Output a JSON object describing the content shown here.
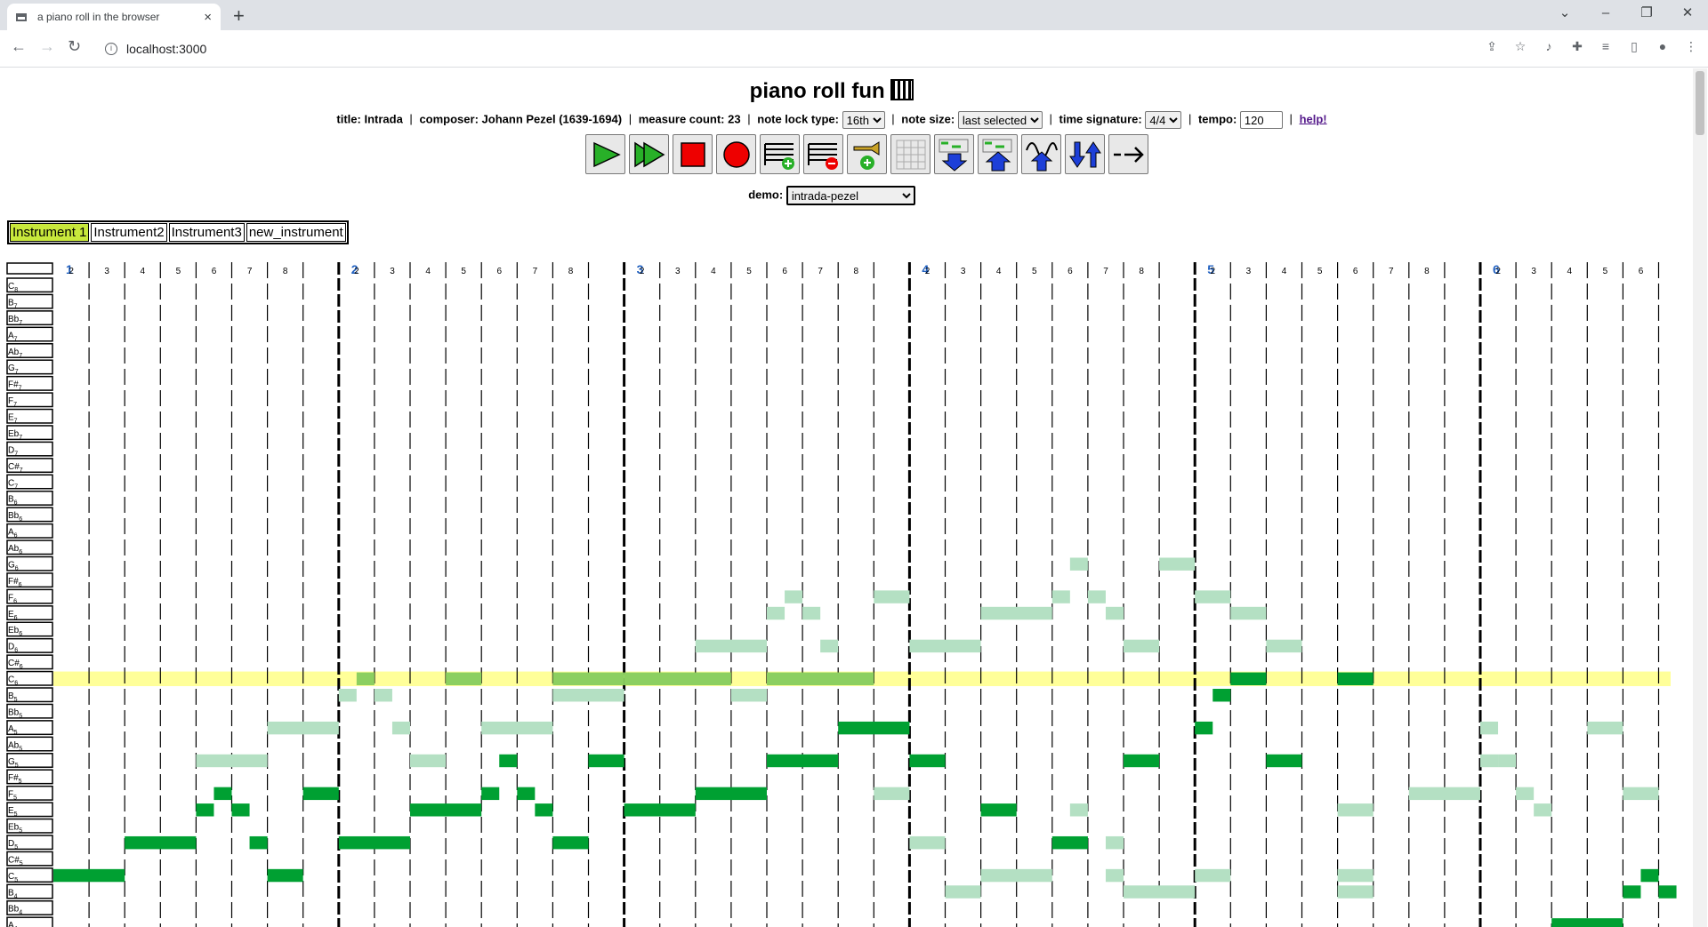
{
  "browser": {
    "tab_title": "a piano roll in the browser",
    "close_glyph": "×",
    "new_tab_glyph": "+",
    "url": "localhost:3000",
    "window_buttons": [
      "⌄",
      "–",
      "❐",
      "✕"
    ]
  },
  "page": {
    "title": "piano roll fun",
    "controls": {
      "title_label": "title:",
      "title_value": "Intrada",
      "composer_label": "composer:",
      "composer_value": "Johann Pezel (1639-1694)",
      "measure_label": "measure count:",
      "measure_value": "23",
      "note_lock_label": "note lock type:",
      "note_lock_value": "16th",
      "note_size_label": "note size:",
      "note_size_value": "last selected",
      "time_sig_label": "time signature:",
      "time_sig_value": "4/4",
      "tempo_label": "tempo:",
      "tempo_value": "120",
      "help_label": "help!"
    },
    "toolbar_buttons": [
      "play",
      "play-all",
      "stop",
      "record",
      "add-measure",
      "remove-measure",
      "add-instrument",
      "toggle-grid",
      "move-down",
      "move-up",
      "wave",
      "transpose",
      "arrow"
    ],
    "demo_label": "demo:",
    "demo_value": "intrada-pezel",
    "instruments": [
      "Instrument 1",
      "Instrument2",
      "Instrument3",
      "new_instrument"
    ],
    "active_instrument": 0
  },
  "roll": {
    "pitch_labels": [
      "C8",
      "B7",
      "Bb7",
      "A7",
      "Ab7",
      "G7",
      "F#7",
      "F7",
      "E7",
      "Eb7",
      "D7",
      "C#7",
      "C7",
      "B6",
      "Bb6",
      "A6",
      "Ab6",
      "G6",
      "F#6",
      "F6",
      "E6",
      "Eb6",
      "D6",
      "C#6",
      "C6",
      "B5",
      "Bb5",
      "A5",
      "Ab5",
      "G5",
      "F#5",
      "F5",
      "E5",
      "Eb5",
      "D5",
      "C#5",
      "C5",
      "B4",
      "Bb4",
      "A4"
    ],
    "highlight_row": "C6",
    "measures": [
      1,
      2,
      3,
      4,
      5,
      6
    ],
    "subdivision_labels": [
      "2",
      "3",
      "4",
      "5",
      "6",
      "7",
      "8"
    ],
    "colors": {
      "active_note": "#00a032",
      "other_note": "#b4e0c3",
      "highlight": "#ffff99",
      "highlight_note": "#8ccf60",
      "measure_num": "#2060c0"
    },
    "active_notes": [
      [
        "C5",
        0,
        2
      ],
      [
        "D5",
        2,
        2
      ],
      [
        "F5",
        4.5,
        0.5
      ],
      [
        "E5",
        4,
        0.5
      ],
      [
        "E5",
        5,
        0.5
      ],
      [
        "D5",
        5.5,
        0.5
      ],
      [
        "C5",
        6,
        1
      ],
      [
        "F5",
        7,
        1
      ],
      [
        "D5",
        8,
        2
      ],
      [
        "E5",
        10,
        2
      ],
      [
        "F5",
        12,
        0.5
      ],
      [
        "G5",
        12.5,
        0.5
      ],
      [
        "F5",
        13,
        0.5
      ],
      [
        "E5",
        13.5,
        0.5
      ],
      [
        "D5",
        14,
        1
      ],
      [
        "G5",
        15,
        1
      ],
      [
        "E5",
        16,
        2
      ],
      [
        "F5",
        18,
        2
      ],
      [
        "G5",
        20,
        2
      ],
      [
        "A5",
        22,
        2
      ],
      [
        "G5",
        24,
        1
      ],
      [
        "E5",
        26,
        1
      ],
      [
        "D5",
        28,
        1
      ],
      [
        "G5",
        30,
        1
      ],
      [
        "A5",
        32,
        0.5
      ],
      [
        "B5",
        32.5,
        0.5
      ],
      [
        "C6",
        33,
        1
      ],
      [
        "G5",
        34,
        1
      ],
      [
        "C6",
        36,
        1
      ],
      [
        "C5",
        44.5,
        0.5
      ],
      [
        "B4",
        44,
        0.5
      ],
      [
        "B4",
        45,
        0.5
      ],
      [
        "A4",
        42,
        2
      ]
    ],
    "other_notes": [
      [
        "G5",
        4,
        2
      ],
      [
        "A5",
        6,
        2
      ],
      [
        "B5",
        8,
        0.5
      ],
      [
        "C6",
        8.5,
        0.5
      ],
      [
        "B5",
        9,
        0.5
      ],
      [
        "A5",
        9.5,
        0.5
      ],
      [
        "G5",
        10,
        1
      ],
      [
        "C6",
        11,
        1
      ],
      [
        "A5",
        12,
        2
      ],
      [
        "C6",
        14,
        2
      ],
      [
        "B5",
        14,
        1
      ],
      [
        "B5",
        15,
        1
      ],
      [
        "C6",
        16,
        3
      ],
      [
        "D6",
        18,
        2
      ],
      [
        "E6",
        20,
        0.5
      ],
      [
        "F6",
        20.5,
        0.5
      ],
      [
        "E6",
        21,
        0.5
      ],
      [
        "D6",
        21.5,
        0.5
      ],
      [
        "C6",
        20,
        3
      ],
      [
        "F6",
        23,
        1
      ],
      [
        "F5",
        23,
        1
      ],
      [
        "B5",
        19,
        1
      ],
      [
        "D6",
        24,
        2
      ],
      [
        "D5",
        24,
        1
      ],
      [
        "B4",
        25,
        1
      ],
      [
        "E6",
        26,
        2
      ],
      [
        "C5",
        26,
        2
      ],
      [
        "G6",
        28.5,
        0.5
      ],
      [
        "F6",
        28,
        0.5
      ],
      [
        "F6",
        29,
        0.5
      ],
      [
        "E6",
        29.5,
        0.5
      ],
      [
        "E5",
        28.5,
        0.5
      ],
      [
        "D5",
        29.5,
        0.5
      ],
      [
        "C5",
        29.5,
        0.5
      ],
      [
        "G6",
        31,
        1
      ],
      [
        "D6",
        30,
        1
      ],
      [
        "B4",
        30,
        2
      ],
      [
        "F6",
        32,
        1
      ],
      [
        "C5",
        32,
        1
      ],
      [
        "E6",
        33,
        1
      ],
      [
        "D6",
        34,
        1
      ],
      [
        "E5",
        36,
        1
      ],
      [
        "C5",
        36,
        1
      ],
      [
        "B4",
        36,
        1
      ],
      [
        "F5",
        38,
        2
      ],
      [
        "A5",
        40,
        0.5
      ],
      [
        "G5",
        40.5,
        0.5
      ],
      [
        "G5",
        40,
        0.5
      ],
      [
        "F5",
        41,
        0.5
      ],
      [
        "E5",
        41.5,
        0.5
      ],
      [
        "A5",
        43,
        1
      ],
      [
        "F5",
        44,
        1
      ]
    ]
  }
}
